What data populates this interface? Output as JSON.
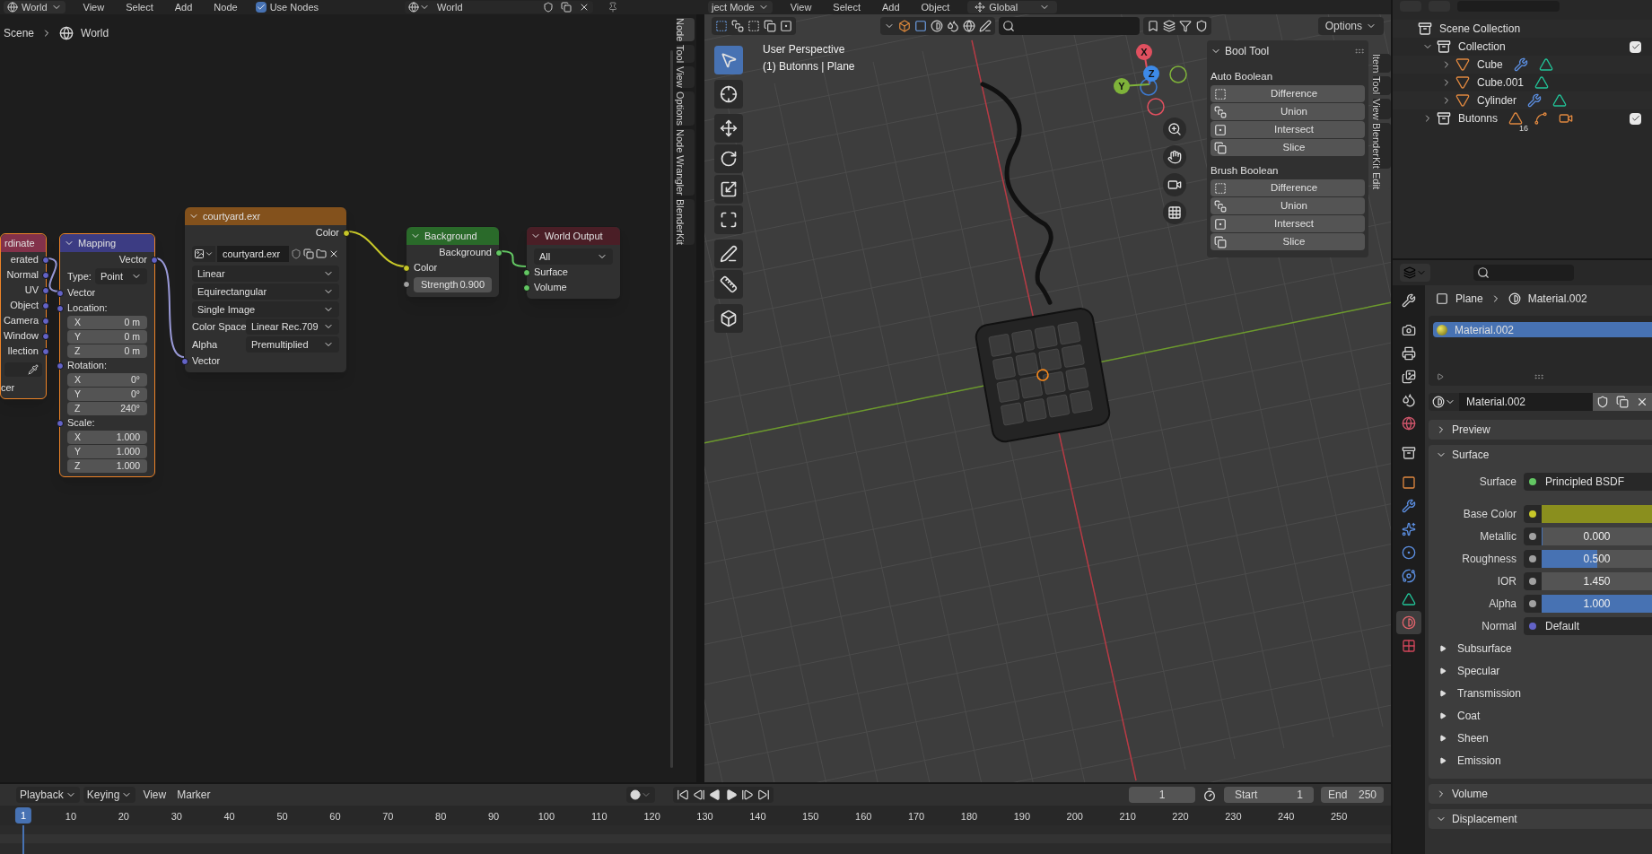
{
  "node_header": {
    "type_menu": "World",
    "menus": [
      "View",
      "Select",
      "Add",
      "Node"
    ],
    "use_nodes": {
      "label": "Use Nodes",
      "checked": true
    },
    "world_field": "World"
  },
  "viewport_header": {
    "mode_menu": "ject Mode",
    "menus": [
      "View",
      "Select",
      "Add",
      "Object"
    ],
    "orientation": "Global"
  },
  "breadcrumb": [
    "Scene",
    "World"
  ],
  "node_tabs": [
    {
      "label": "Node",
      "selected": true
    },
    {
      "label": "Tool",
      "selected": false
    },
    {
      "label": "View",
      "selected": false
    },
    {
      "label": "Options",
      "selected": false
    },
    {
      "label": "Node Wrangler",
      "selected": false
    },
    {
      "label": "BlenderKit",
      "selected": false
    }
  ],
  "nodes": [
    {
      "kind": "texture_coordinate",
      "title": "rdinate",
      "selected": true,
      "outputs": [
        "erated",
        "Normal",
        "UV",
        "Object",
        "Camera",
        "Window",
        "llection"
      ],
      "footer": "cer"
    },
    {
      "kind": "mapping",
      "title": "Mapping",
      "selected": true,
      "output": "Vector",
      "type_label": "Type:",
      "type_value": "Point",
      "input": "Vector",
      "groups": [
        {
          "label": "Location:",
          "rows": [
            {
              "axis": "X",
              "value": "0 m"
            },
            {
              "axis": "Y",
              "value": "0 m"
            },
            {
              "axis": "Z",
              "value": "0 m"
            }
          ]
        },
        {
          "label": "Rotation:",
          "rows": [
            {
              "axis": "X",
              "value": "0°"
            },
            {
              "axis": "Y",
              "value": "0°"
            },
            {
              "axis": "Z",
              "value": "240°"
            }
          ]
        },
        {
          "label": "Scale:",
          "rows": [
            {
              "axis": "X",
              "value": "1.000"
            },
            {
              "axis": "Y",
              "value": "1.000"
            },
            {
              "axis": "Z",
              "value": "1.000"
            }
          ]
        }
      ]
    },
    {
      "kind": "image",
      "title": "courtyard.exr",
      "selected": false,
      "output": "Color",
      "image_name": "courtyard.exr",
      "dropdowns": [
        "Linear",
        "Equirectangular",
        "Single Image"
      ],
      "fields": [
        {
          "label": "Color Space",
          "value": "Linear Rec.709"
        },
        {
          "label": "Alpha",
          "value": "Premultiplied"
        }
      ],
      "input": "Vector"
    },
    {
      "kind": "background",
      "title": "Background",
      "selected": false,
      "output": "Background",
      "input": "Color",
      "strength": {
        "label": "Strength",
        "value": "0.900"
      }
    },
    {
      "kind": "output",
      "title": "World Output",
      "selected": false,
      "target": "All",
      "inputs": [
        "Surface",
        "Volume"
      ]
    }
  ],
  "viewport": {
    "view_label": "User Perspective",
    "object_label": "(1) Butonns | Plane",
    "options": "Options",
    "toolbar": [
      {
        "kind": "select",
        "selected": true
      },
      {
        "kind": "cursor",
        "selected": false
      },
      {
        "kind": "move",
        "selected": false
      },
      {
        "kind": "rotate",
        "selected": false
      },
      {
        "kind": "scale",
        "selected": false
      },
      {
        "kind": "transform",
        "selected": false
      },
      {
        "kind": "annotate",
        "selected": false
      },
      {
        "kind": "measure",
        "selected": false
      },
      {
        "kind": "add_cube",
        "selected": false
      }
    ],
    "gizmo_axes": [
      "X",
      "Y",
      "Z"
    ],
    "bool_tool": {
      "title": "Bool Tool",
      "sections": [
        {
          "title": "Auto Boolean",
          "buttons": [
            {
              "kind": "difference",
              "label": "Difference"
            },
            {
              "kind": "union",
              "label": "Union"
            },
            {
              "kind": "intersect",
              "label": "Intersect"
            },
            {
              "kind": "slice",
              "label": "Slice"
            }
          ]
        },
        {
          "title": "Brush Boolean",
          "buttons": [
            {
              "kind": "difference",
              "label": "Difference"
            },
            {
              "kind": "union",
              "label": "Union"
            },
            {
              "kind": "intersect",
              "label": "Intersect"
            },
            {
              "kind": "slice",
              "label": "Slice"
            }
          ]
        }
      ]
    },
    "tabs": [
      {
        "label": "Item",
        "selected": false
      },
      {
        "label": "Tool",
        "selected": false
      },
      {
        "label": "View",
        "selected": false
      },
      {
        "label": "BlenderKit",
        "selected": false
      },
      {
        "label": "Edit",
        "selected": true
      }
    ]
  },
  "outliner": {
    "tree": [
      {
        "label": "Scene Collection",
        "kind": "scene",
        "children": [
          {
            "label": "Collection",
            "kind": "collection",
            "expanded": true,
            "checked": true,
            "children": [
              {
                "label": "Cube",
                "kind": "mesh",
                "expanded": false,
                "icons": [
                  {
                    "kind": "modifier"
                  },
                  {
                    "kind": "mesh"
                  }
                ]
              },
              {
                "label": "Cube.001",
                "kind": "mesh",
                "expanded": false,
                "icons": [
                  {
                    "kind": "mesh"
                  }
                ]
              },
              {
                "label": "Cylinder",
                "kind": "mesh",
                "expanded": false,
                "icons": [
                  {
                    "kind": "modifier"
                  },
                  {
                    "kind": "mesh"
                  }
                ]
              }
            ]
          },
          {
            "label": "Butonns",
            "kind": "collection",
            "expanded": false,
            "checked": true,
            "icons": [
              {
                "kind": "object",
                "count": "16"
              },
              {
                "kind": "curve"
              },
              {
                "kind": "camera"
              }
            ]
          }
        ]
      }
    ]
  },
  "properties": {
    "tabs": [
      {
        "kind": "tool",
        "selected": false
      },
      {
        "kind": "render",
        "selected": false
      },
      {
        "kind": "output",
        "selected": false
      },
      {
        "kind": "view_layer",
        "selected": false
      },
      {
        "kind": "scene",
        "selected": false
      },
      {
        "kind": "world",
        "selected": false
      },
      {
        "kind": "collection",
        "selected": false
      },
      {
        "kind": "object",
        "selected": false
      },
      {
        "kind": "modifiers",
        "selected": false
      },
      {
        "kind": "particles",
        "selected": false
      },
      {
        "kind": "physics",
        "selected": false
      },
      {
        "kind": "constraints",
        "selected": false
      },
      {
        "kind": "data",
        "selected": false
      },
      {
        "kind": "material",
        "selected": true
      },
      {
        "kind": "texture",
        "selected": false
      }
    ],
    "breadcrumb": [
      "Plane",
      "Material.002"
    ],
    "slots": [
      {
        "label": "Material.002",
        "selected": true
      }
    ],
    "material_field": "Material.002",
    "panels": [
      {
        "title": "Preview",
        "expanded": false
      },
      {
        "title": "Surface",
        "expanded": true,
        "rows": [
          {
            "kind": "shader",
            "label": "Surface",
            "value": "Principled BSDF",
            "socket": {
              "color": "#63c763"
            }
          },
          {
            "kind": "swatch",
            "label": "Base Color",
            "swatch": {
              "color": "#8a8f1e"
            },
            "socket": {
              "color": "#c7c729"
            }
          },
          {
            "kind": "slider",
            "label": "Metallic",
            "value": "0.000",
            "level": 0,
            "socket": {
              "color": "#a1a1a1"
            }
          },
          {
            "kind": "slider",
            "label": "Roughness",
            "value": "0.500",
            "level": 0.5,
            "socket": {
              "color": "#a1a1a1"
            }
          },
          {
            "kind": "number",
            "label": "IOR",
            "value": "1.450",
            "socket": {
              "color": "#a1a1a1"
            }
          },
          {
            "kind": "slider",
            "label": "Alpha",
            "value": "1.000",
            "level": 1,
            "socket": {
              "color": "#a1a1a1"
            }
          },
          {
            "kind": "link",
            "label": "Normal",
            "value": "Default",
            "socket": {
              "color": "#6363c7"
            }
          }
        ],
        "subpanels": [
          {
            "title": "Subsurface",
            "expanded": false
          },
          {
            "title": "Specular",
            "expanded": false
          },
          {
            "title": "Transmission",
            "expanded": false
          },
          {
            "title": "Coat",
            "expanded": false
          },
          {
            "title": "Sheen",
            "expanded": false
          },
          {
            "title": "Emission",
            "expanded": false
          }
        ]
      },
      {
        "title": "Volume",
        "expanded": false
      },
      {
        "title": "Displacement",
        "expanded": true
      }
    ]
  },
  "timeline": {
    "menus": [
      {
        "label": "Playback",
        "dropdown": true
      },
      {
        "label": "Keying",
        "dropdown": true
      },
      {
        "label": "View",
        "dropdown": false
      },
      {
        "label": "Marker",
        "dropdown": false
      }
    ],
    "current_frame": "1",
    "start": {
      "label": "Start",
      "value": "1"
    },
    "end": {
      "label": "End",
      "value": "250"
    },
    "playhead": "1",
    "ruler": [
      "10",
      "20",
      "30",
      "40",
      "50",
      "60",
      "70",
      "80",
      "90",
      "100",
      "110",
      "120",
      "130",
      "140",
      "150",
      "160",
      "170",
      "180",
      "190",
      "200",
      "210",
      "220",
      "230",
      "240",
      "250"
    ]
  }
}
